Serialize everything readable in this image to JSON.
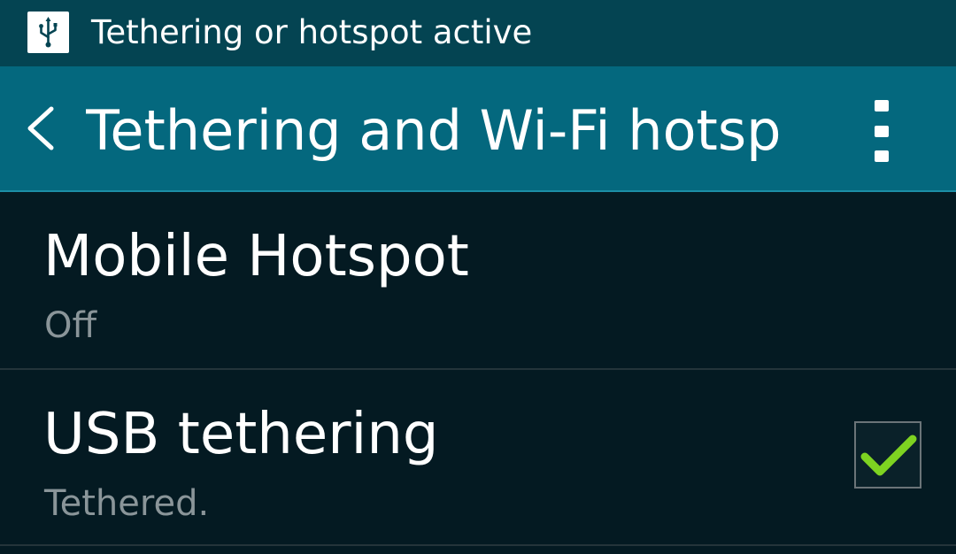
{
  "status_bar": {
    "notification_icon": "usb-icon",
    "text": "Tethering or hotspot active"
  },
  "action_bar": {
    "back_icon": "back-arrow-icon",
    "title": "Tethering and Wi-Fi hotsp..",
    "overflow_icon": "overflow-menu-icon"
  },
  "list": {
    "items": [
      {
        "title": "Mobile Hotspot",
        "summary": "Off"
      },
      {
        "title": "USB tethering",
        "summary": "Tethered.",
        "checked": true
      }
    ]
  },
  "colors": {
    "status_bar": "#044452",
    "action_bar": "#04687e",
    "background": "#041a22",
    "check_mark": "#7ed321"
  }
}
